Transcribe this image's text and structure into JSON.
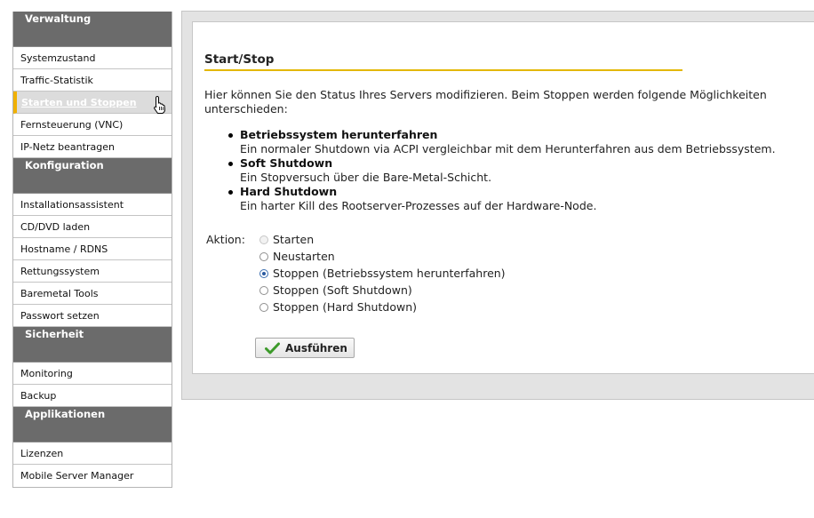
{
  "sidebar": {
    "sections": [
      {
        "title": "Verwaltung",
        "items": [
          "Systemzustand",
          "Traffic-Statistik",
          "Starten und Stoppen",
          "Fernsteuerung (VNC)",
          "IP-Netz beantragen"
        ]
      },
      {
        "title": "Konfiguration",
        "items": [
          "Installationsassistent",
          "CD/DVD laden",
          "Hostname / RDNS",
          "Rettungssystem",
          "Baremetal Tools",
          "Passwort setzen"
        ]
      },
      {
        "title": "Sicherheit",
        "items": [
          "Monitoring",
          "Backup"
        ]
      },
      {
        "title": "Applikationen",
        "items": [
          "Lizenzen",
          "Mobile Server Manager"
        ]
      }
    ]
  },
  "main": {
    "title": "Start/Stop",
    "intro": "Hier können Sie den Status Ihres Servers modifizieren. Beim Stoppen werden folgende Möglichkeiten unterschieden:",
    "bullets": [
      {
        "title": "Betriebssystem herunterfahren",
        "desc": "Ein normaler Shutdown via ACPI vergleichbar mit dem Herunterfahren aus dem Betriebssystem."
      },
      {
        "title": "Soft Shutdown",
        "desc": "Ein Stopversuch über die Bare-Metal-Schicht."
      },
      {
        "title": "Hard Shutdown",
        "desc": "Ein harter Kill des Rootserver-Prozesses auf der Hardware-Node."
      }
    ],
    "action_label": "Aktion:",
    "options": [
      {
        "label": "Starten",
        "state": "disabled"
      },
      {
        "label": "Neustarten",
        "state": "unchecked"
      },
      {
        "label": "Stoppen (Betriebssystem herunterfahren)",
        "state": "checked"
      },
      {
        "label": "Stoppen (Soft Shutdown)",
        "state": "unchecked"
      },
      {
        "label": "Stoppen (Hard Shutdown)",
        "state": "unchecked"
      }
    ],
    "run_button": "Ausführen"
  },
  "colors": {
    "accent": "#e3b800",
    "sidebar_header": "#6b6b6b",
    "check_icon": "#3c9a2a"
  },
  "icons": {
    "cursor": "hand-pointer-icon",
    "run": "checkmark-icon"
  }
}
